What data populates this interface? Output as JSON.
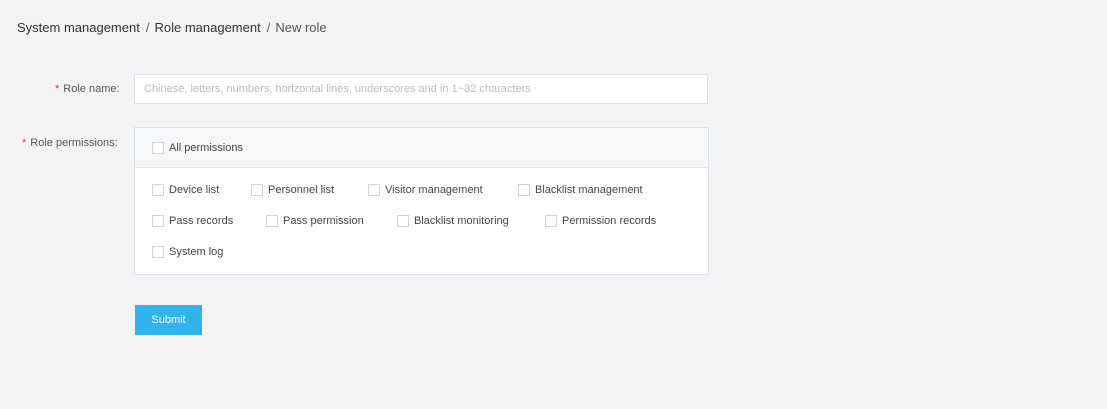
{
  "breadcrumb": {
    "items": [
      "System management",
      "Role management",
      "New role"
    ],
    "separator": "/"
  },
  "form": {
    "required_mark": "*",
    "role_name": {
      "label": "Role name:",
      "value": "",
      "placeholder": "Chinese, letters, numbers, horizontal lines, underscores and in 1~32 characters"
    },
    "role_permissions": {
      "label": "Role permissions:",
      "all_label": "All permissions",
      "options": [
        {
          "label": "Device list",
          "checked": false
        },
        {
          "label": "Personnel list",
          "checked": false
        },
        {
          "label": "Visitor management",
          "checked": false
        },
        {
          "label": "Blacklist management",
          "checked": false
        },
        {
          "label": "Pass records",
          "checked": false
        },
        {
          "label": "Pass permission",
          "checked": false
        },
        {
          "label": "Blacklist monitoring",
          "checked": false
        },
        {
          "label": "Permission records",
          "checked": false
        },
        {
          "label": "System log",
          "checked": false
        }
      ]
    },
    "submit_label": "Submit"
  },
  "colors": {
    "accent": "#2fb4ec",
    "required": "#e0382d",
    "page_background": "#f2f3f4"
  }
}
